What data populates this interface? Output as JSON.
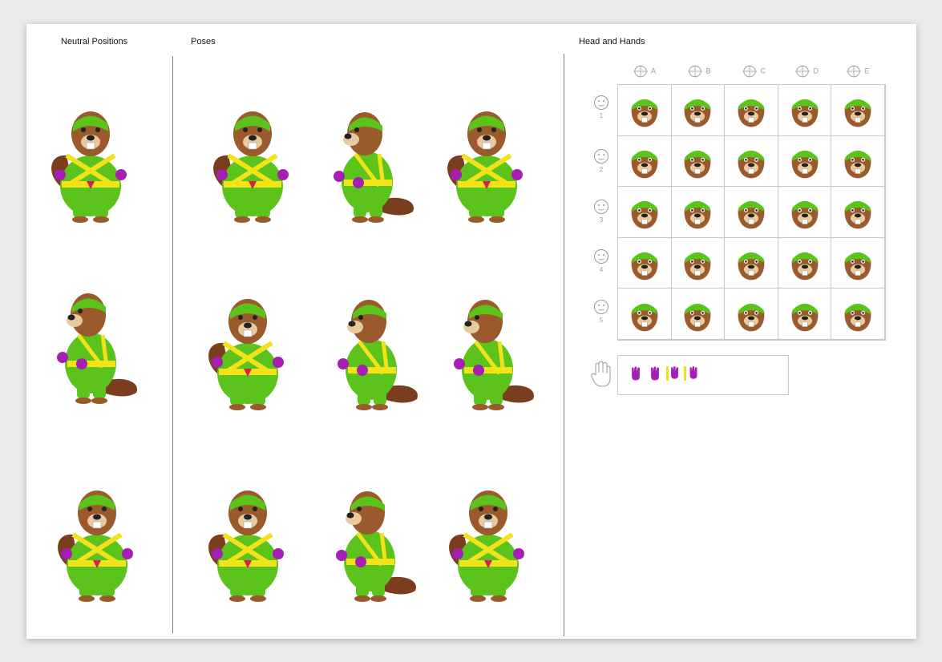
{
  "sections": {
    "neutral_title": "Neutral Positions",
    "poses_title": "Poses",
    "head_hands_title": "Head and Hands"
  },
  "grid": {
    "columns": [
      "A",
      "B",
      "C",
      "D",
      "E"
    ],
    "rows": [
      "1",
      "2",
      "3",
      "4",
      "5"
    ]
  },
  "colors": {
    "suit": "#5bc31b",
    "fur": "#9a5a2b",
    "strap": "#f2e21a",
    "glove": "#a51fb2",
    "tail": "#7a3e1f"
  },
  "icons": {
    "column_heads": [
      "head-turn-a-icon",
      "head-turn-b-icon",
      "head-turn-c-icon",
      "head-turn-d-icon",
      "head-turn-e-icon"
    ],
    "row_faces": [
      "neutral-face-icon",
      "worried-face-icon",
      "angry-face-icon",
      "happy-face-icon",
      "surprised-face-icon"
    ],
    "hand": "hand-outline-icon"
  }
}
